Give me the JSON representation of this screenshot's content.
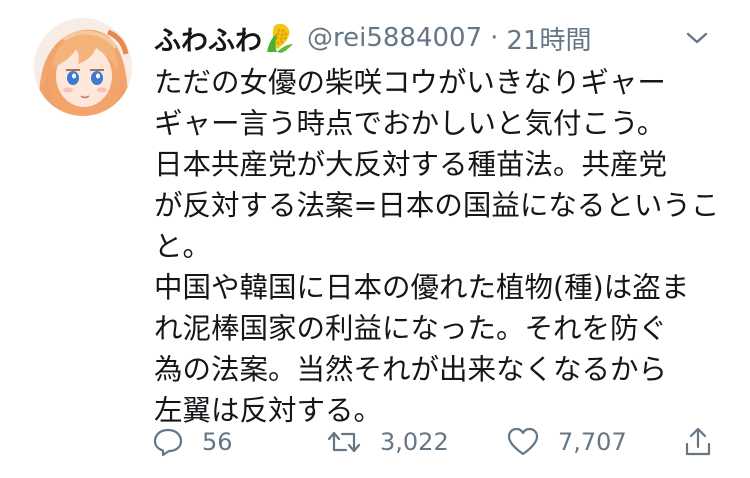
{
  "user": {
    "display_name": "ふわふわ",
    "handle": "@rei5884007",
    "separator": "·",
    "time": "21時間"
  },
  "tweet": {
    "lines": [
      "ただの女優の柴咲コウがいきなりギャー",
      "ギャー言う時点でおかしいと気付こう。",
      "日本共産党が大反対する種苗法。共産党",
      "が反対する法案=日本の国益になるというこ",
      "と。",
      "中国や韓国に日本の優れた植物(種)は盗ま",
      "れ泥棒国家の利益になった。それを防ぐ",
      "為の法案。当然それが出来なくなるから",
      "左翼は反対する。"
    ]
  },
  "actions": {
    "reply_count": "56",
    "retweet_count": "3,022",
    "like_count": "7,707"
  },
  "icons": {
    "name_emoji": "corn-icon",
    "menu": "chevron-down-icon",
    "reply": "reply-icon",
    "retweet": "retweet-icon",
    "like": "heart-icon",
    "share": "share-icon"
  },
  "colors": {
    "text": "#14171a",
    "secondary": "#657786",
    "background": "#ffffff"
  }
}
